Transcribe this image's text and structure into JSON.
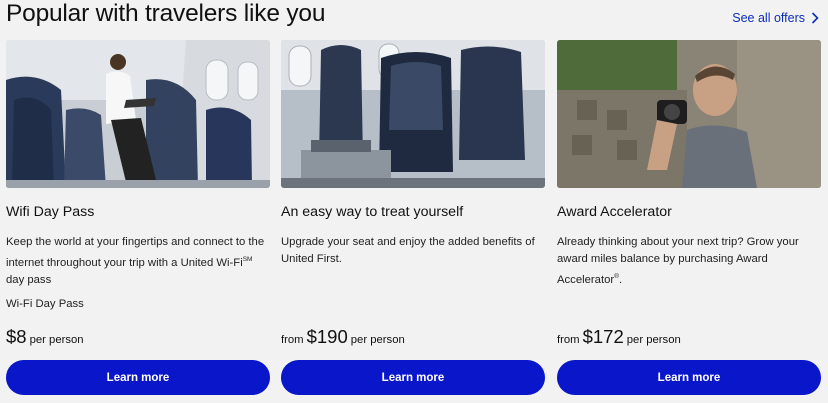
{
  "section": {
    "title": "Popular with travelers like you",
    "see_all": "See all offers"
  },
  "cards": [
    {
      "title": "Wifi Day Pass",
      "desc_main": "Keep the world at your fingertips and connect to the internet throughout your trip with a United Wi-Fi",
      "desc_sup": "SM",
      "desc_tail": " day pass",
      "sub": "Wi-Fi Day Pass",
      "price_from": "",
      "price": "$8",
      "per": "per person",
      "button": "Learn more"
    },
    {
      "title": "An easy way to treat yourself",
      "desc_main": "Upgrade your seat and enjoy the added benefits of United First.",
      "price_from": "from",
      "price": "$190",
      "per": "per person",
      "button": "Learn more"
    },
    {
      "title": "Award Accelerator",
      "desc_main": "Already thinking about your next trip? Grow your award miles balance by purchasing Award Accelerator",
      "desc_reg": "®",
      "desc_tail": ".",
      "price_from": "from",
      "price": "$172",
      "per": "per person",
      "button": "Learn more"
    }
  ],
  "icons": {
    "see_all": "chevron-right-icon"
  },
  "colors": {
    "accent": "#0a16c9",
    "link": "#0c2fb6",
    "background": "#f2f2f2"
  }
}
